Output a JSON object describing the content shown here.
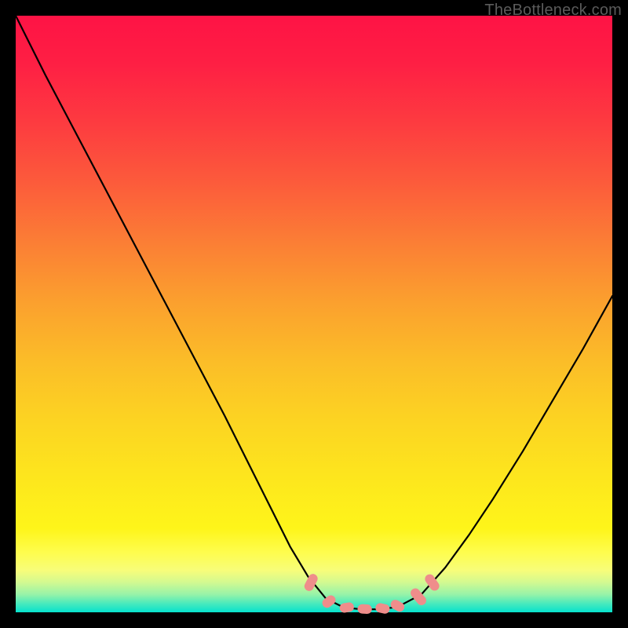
{
  "watermark": {
    "text": "TheBottleneck.com"
  },
  "chart_data": {
    "type": "line",
    "title": "",
    "xlabel": "",
    "ylabel": "",
    "xlim": [
      0,
      100
    ],
    "ylim": [
      0,
      100
    ],
    "grid": false,
    "legend": false,
    "series": [
      {
        "name": "bottleneck-curve",
        "color": "#000000",
        "x": [
          0,
          5,
          10,
          15,
          20,
          25,
          30,
          35,
          40,
          43,
          46,
          49,
          52,
          55,
          58,
          61,
          64,
          68,
          72,
          76,
          80,
          85,
          90,
          95,
          100
        ],
        "y": [
          100,
          90,
          80.5,
          71,
          61.5,
          52,
          42.5,
          33,
          23,
          17,
          11,
          6,
          2.3,
          0.8,
          0.5,
          0.5,
          0.9,
          3,
          7.5,
          13,
          19,
          27,
          35.5,
          44,
          53
        ]
      }
    ],
    "markers": [
      {
        "name": "highlight-dots",
        "color": "#ef8d8b",
        "shape": "pill",
        "points": [
          {
            "x": 49.5,
            "y": 5.0,
            "len": 3.0,
            "angle": -63
          },
          {
            "x": 52.5,
            "y": 1.8,
            "len": 2.4,
            "angle": -38
          },
          {
            "x": 55.5,
            "y": 0.8,
            "len": 2.4,
            "angle": -10
          },
          {
            "x": 58.5,
            "y": 0.55,
            "len": 2.4,
            "angle": 3
          },
          {
            "x": 61.5,
            "y": 0.65,
            "len": 2.4,
            "angle": 12
          },
          {
            "x": 64.0,
            "y": 1.1,
            "len": 2.4,
            "angle": 30
          },
          {
            "x": 67.5,
            "y": 2.6,
            "len": 3.2,
            "angle": 50
          },
          {
            "x": 69.8,
            "y": 5.0,
            "len": 3.0,
            "angle": 55
          }
        ]
      }
    ]
  }
}
